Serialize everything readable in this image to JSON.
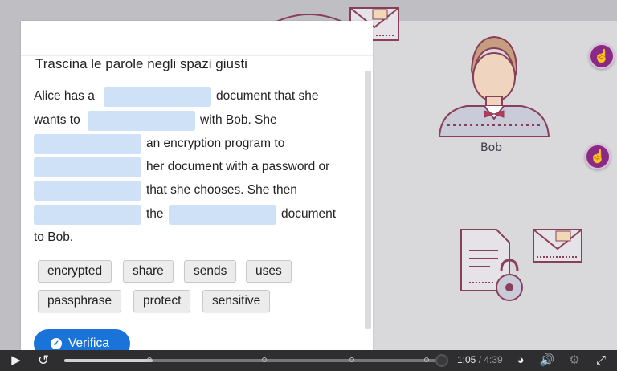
{
  "question": "Trascina le parole negli spazi giusti",
  "text_segments": {
    "l1a": "Alice has a",
    "l1b": "document that she",
    "l2a": "wants to",
    "l2b": "with Bob. She",
    "l3a": "an encryption program to",
    "l4a": "her document with a password or",
    "l5a": "that she chooses. She then",
    "l6a": "the",
    "l6b": "document",
    "l7a": "to Bob."
  },
  "word_bank": [
    "encrypted",
    "share",
    "sends",
    "uses",
    "passphrase",
    "protect",
    "sensitive"
  ],
  "check_button": "Verifica",
  "illustration": {
    "bob_label": "Bob"
  },
  "player": {
    "current": "1:05",
    "duration": "/ 4:39",
    "progress_fraction": 0.233
  },
  "colors": {
    "blank": "#cfe1f6",
    "primary": "#1a73d9",
    "hotspot": "#8b2a86"
  }
}
